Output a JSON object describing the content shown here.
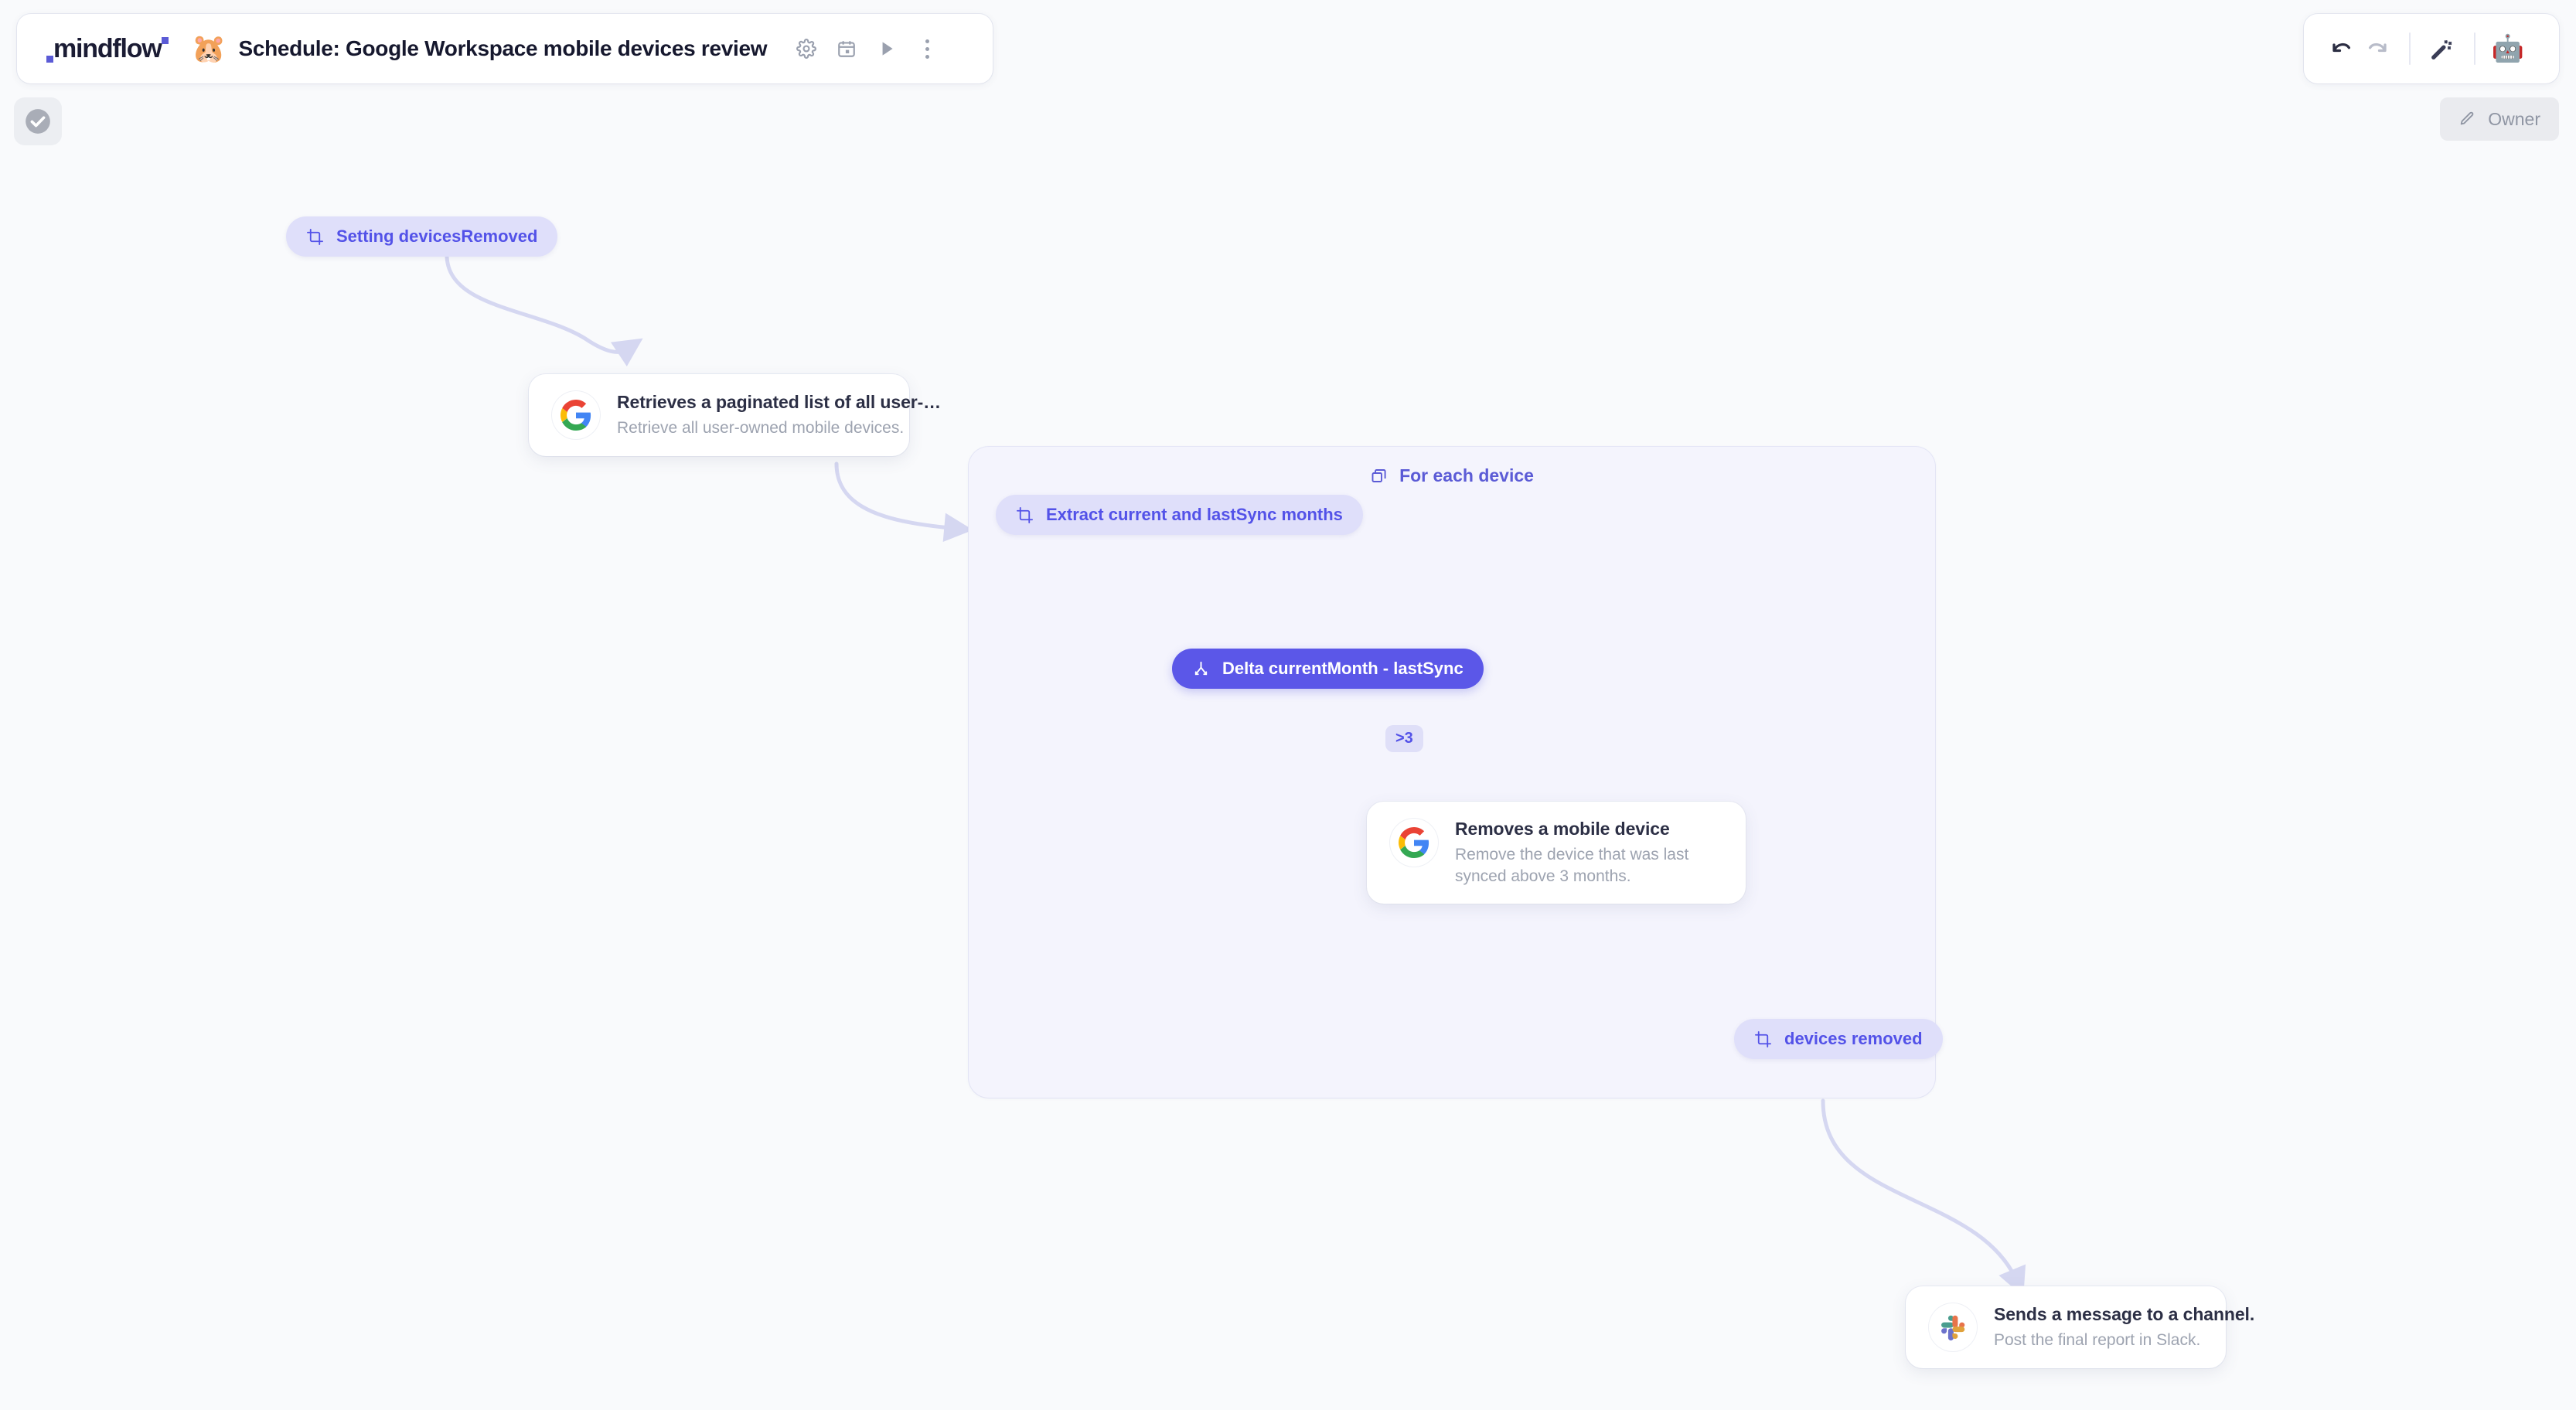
{
  "brand": {
    "name": "mindflow"
  },
  "header": {
    "workflow_emoji": "🐹",
    "workflow_title": "Schedule: Google Workspace mobile devices review",
    "icons": [
      {
        "name": "settings-icon",
        "label": "Settings"
      },
      {
        "name": "schedule-icon",
        "label": "Schedule"
      },
      {
        "name": "run-icon",
        "label": "Run"
      },
      {
        "name": "more-options-icon",
        "label": "More options"
      }
    ]
  },
  "toolbar": {
    "undo_label": "Undo",
    "redo_label": "Redo",
    "magic_label": "Auto-arrange",
    "avatar_emoji": "🤖"
  },
  "owner": {
    "label": "Owner",
    "icon": "pencil-icon"
  },
  "status": {
    "icon": "check-circle-icon",
    "label": "Valid"
  },
  "colors": {
    "canvas_background": "#f9fafc",
    "accent": "#5b57e8",
    "pill_background": "#dfdffa",
    "pill_text": "#5352e8",
    "loop_background": "#f4f4fd",
    "edge": "#d8daf4",
    "card_title": "#2c2f45",
    "card_subtitle": "#9da3b0"
  },
  "canvas": {
    "loop": {
      "title": "For each device",
      "icon": "layers-icon"
    },
    "nodes": [
      {
        "id": "setting-devices-removed",
        "type": "pill",
        "icon": "transform-icon",
        "label": "Setting devicesRemoved"
      },
      {
        "id": "retrieve-devices",
        "type": "card",
        "logo": "google-icon",
        "title": "Retrieves a paginated list of all user-…",
        "subtitle": "Retrieve all user-owned mobile devices."
      },
      {
        "id": "extract-months",
        "type": "pill",
        "icon": "transform-icon",
        "label": "Extract current and lastSync months"
      },
      {
        "id": "delta-month",
        "type": "pill-filled",
        "icon": "branch-icon",
        "label": "Delta currentMonth - lastSync"
      },
      {
        "id": "remove-device",
        "type": "card",
        "logo": "google-icon",
        "title": "Removes a mobile device",
        "subtitle": "Remove the device that was last synced above 3 months."
      },
      {
        "id": "devices-removed",
        "type": "pill",
        "icon": "transform-icon",
        "label": "devices removed"
      },
      {
        "id": "slack-message",
        "type": "card",
        "logo": "slack-icon",
        "title": "Sends a message to a channel.",
        "subtitle": "Post the final report in Slack."
      }
    ],
    "edge_labels": [
      {
        "id": "delta-condition",
        "label": ">3"
      }
    ]
  }
}
